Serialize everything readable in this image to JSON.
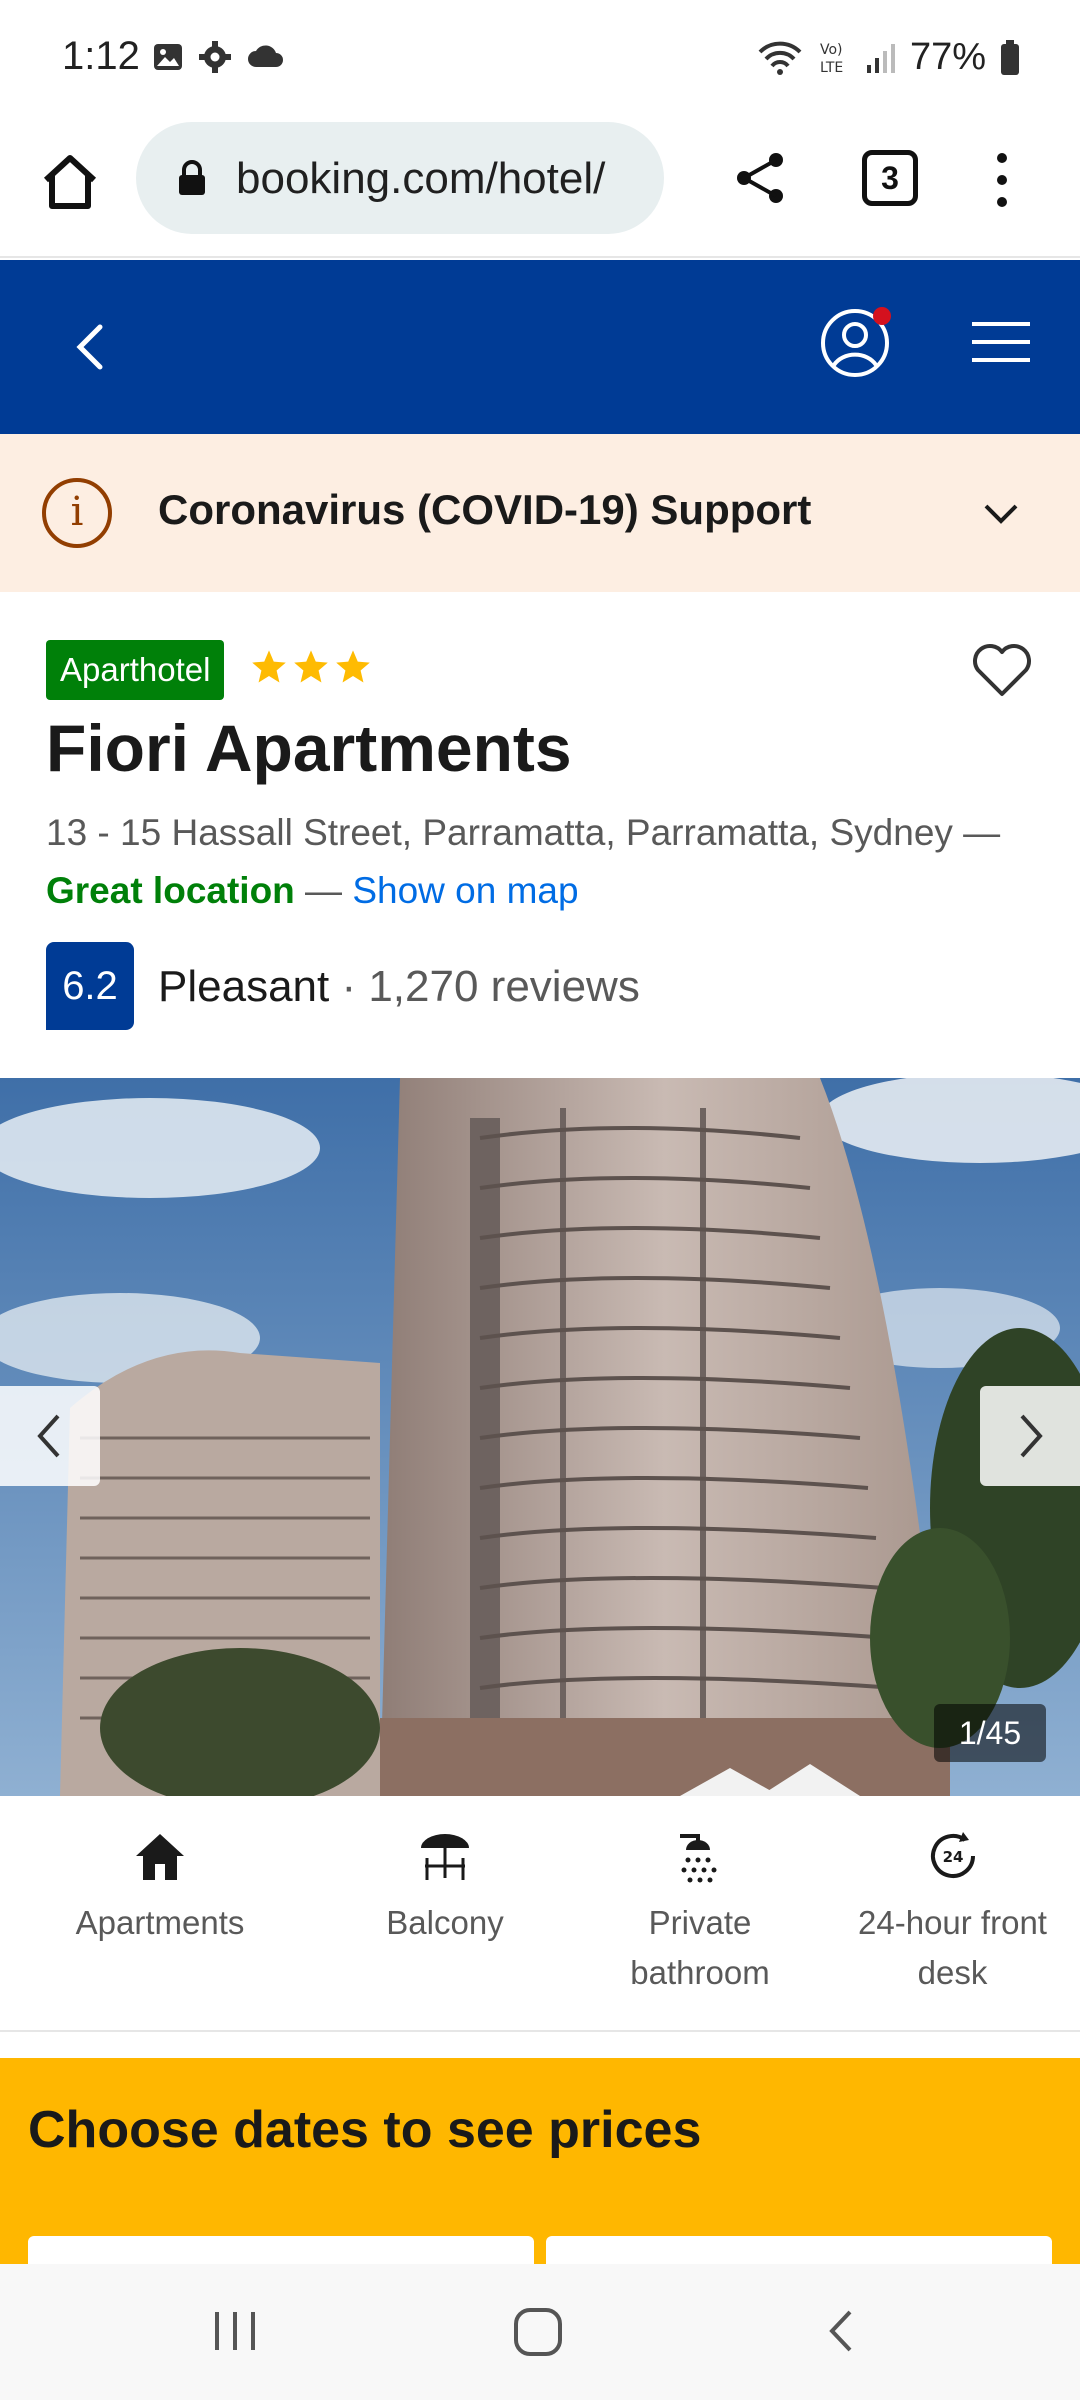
{
  "status_bar": {
    "time": "1:12",
    "battery": "77%"
  },
  "browser": {
    "url": "booking.com/hotel/",
    "tab_count": "3"
  },
  "covid_banner": {
    "text": "Coronavirus (COVID-19) Support"
  },
  "hotel": {
    "type_badge": "Aparthotel",
    "star_count": 3,
    "name": "Fiori Apartments",
    "address": "13 - 15 Hassall Street, Parramatta, Parramatta, Sydney —",
    "location_label": "Great location",
    "location_dash": " — ",
    "show_map": "Show on map",
    "score": "6.2",
    "score_word": "Pleasant",
    "review_text": " · 1,270 reviews"
  },
  "photo": {
    "counter": "1/45"
  },
  "facilities": [
    {
      "icon": "house-icon",
      "label": "Apartments"
    },
    {
      "icon": "balcony-icon",
      "label": "Balcony"
    },
    {
      "icon": "shower-icon",
      "label": "Private bathroom"
    },
    {
      "icon": "24h-icon",
      "label": "24-hour front desk"
    }
  ],
  "dates_section": {
    "title": "Choose dates to see prices"
  },
  "colors": {
    "brand_blue": "#003b95",
    "green": "#008009",
    "link_blue": "#006ce4",
    "yellow": "#ffb700",
    "star": "#febb02"
  }
}
